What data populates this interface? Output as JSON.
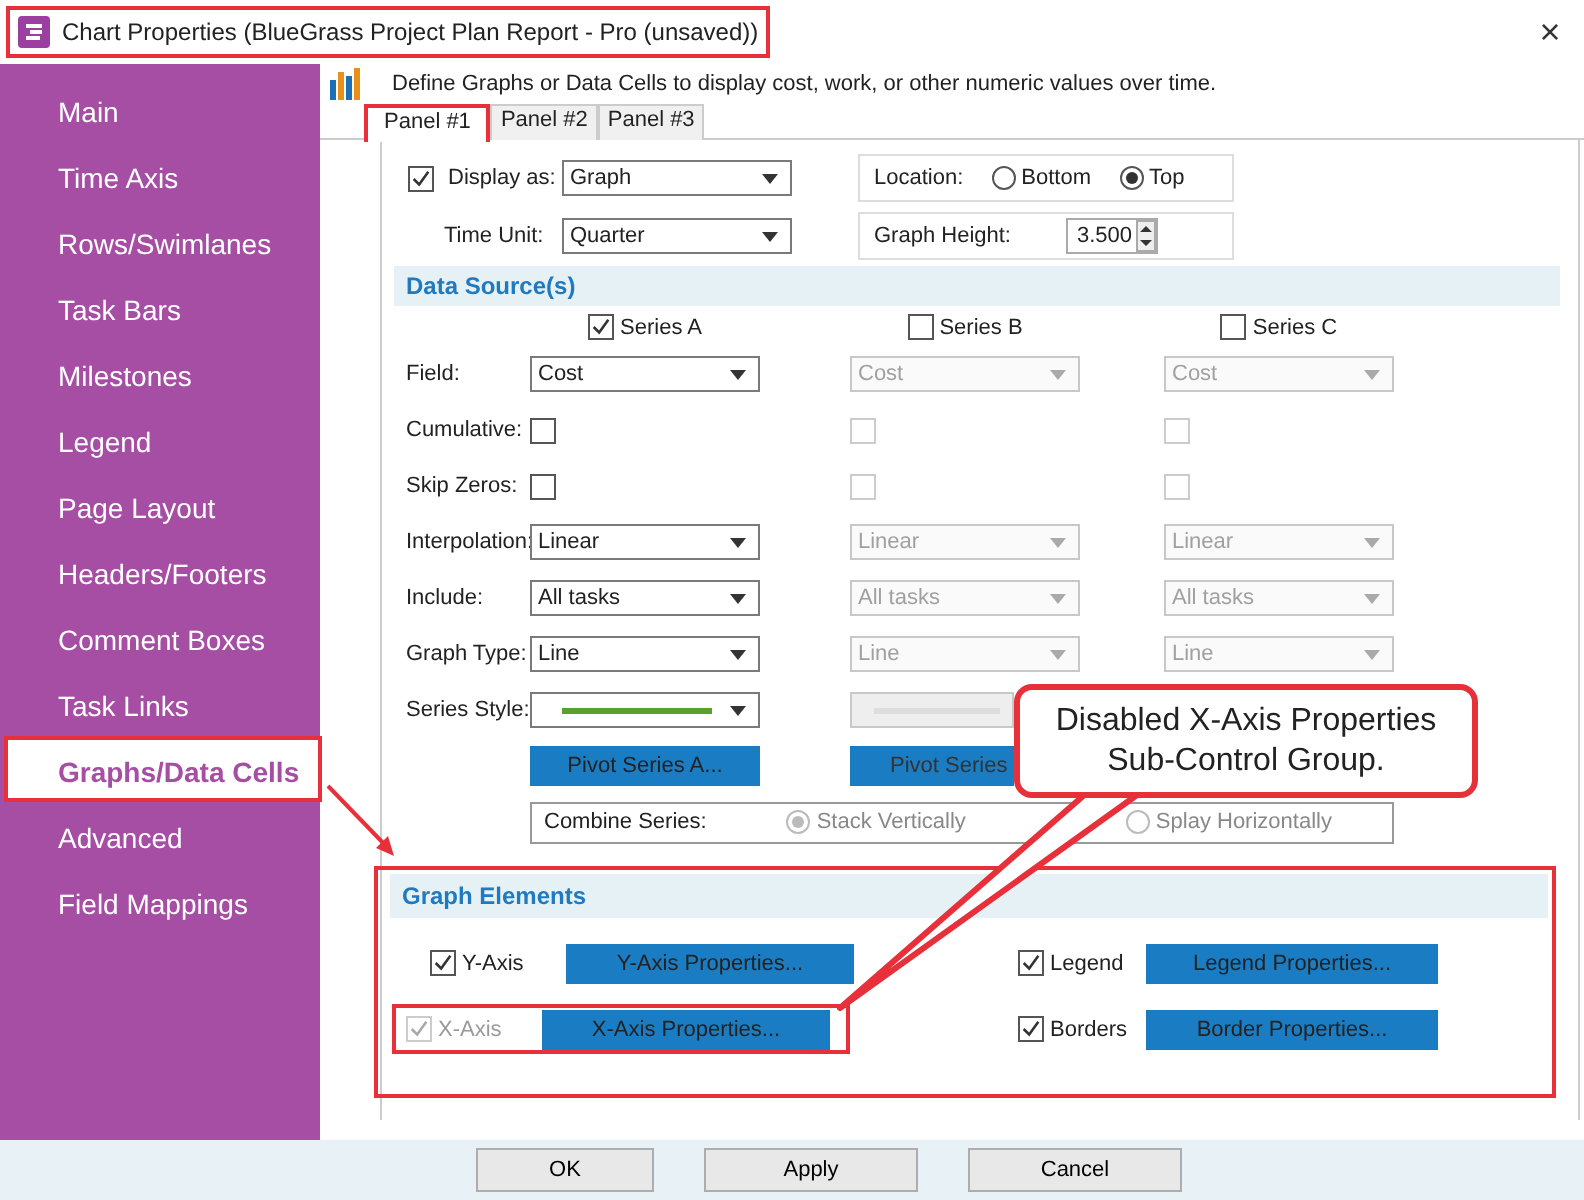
{
  "window": {
    "title": "Chart Properties (BlueGrass Project Plan Report - Pro (unsaved))",
    "highlighted": true,
    "close": "×"
  },
  "sidebar": {
    "items": [
      {
        "label": "Main",
        "selected": false
      },
      {
        "label": "Time Axis",
        "selected": false
      },
      {
        "label": "Rows/Swimlanes",
        "selected": false
      },
      {
        "label": "Task Bars",
        "selected": false
      },
      {
        "label": "Milestones",
        "selected": false
      },
      {
        "label": "Legend",
        "selected": false
      },
      {
        "label": "Page Layout",
        "selected": false
      },
      {
        "label": "Headers/Footers",
        "selected": false
      },
      {
        "label": "Comment Boxes",
        "selected": false
      },
      {
        "label": "Task Links",
        "selected": false
      },
      {
        "label": "Graphs/Data Cells",
        "selected": true
      },
      {
        "label": "Advanced",
        "selected": false
      },
      {
        "label": "Field Mappings",
        "selected": false
      }
    ]
  },
  "description": "Define Graphs or Data Cells to display cost, work, or other numeric values over time.",
  "tabs": [
    {
      "label": "Panel #1",
      "selected": true,
      "highlighted": true
    },
    {
      "label": "Panel #2",
      "selected": false,
      "highlighted": false
    },
    {
      "label": "Panel #3",
      "selected": false,
      "highlighted": false
    }
  ],
  "display_as": {
    "label": "Display as:",
    "checked": true,
    "value": "Graph"
  },
  "time_unit": {
    "label": "Time Unit:",
    "value": "Quarter"
  },
  "location": {
    "label": "Location:",
    "options": [
      {
        "label": "Bottom",
        "selected": false
      },
      {
        "label": "Top",
        "selected": true
      }
    ]
  },
  "graph_height": {
    "label": "Graph Height:",
    "value": "3.500"
  },
  "data_sources": {
    "title": "Data Source(s)",
    "series": [
      {
        "label": "Series A",
        "checked": true
      },
      {
        "label": "Series B",
        "checked": false
      },
      {
        "label": "Series C",
        "checked": false
      }
    ],
    "rows": [
      {
        "kind": "dropdown",
        "label": "Field:",
        "cells": [
          {
            "value": "Cost",
            "disabled": false
          },
          {
            "value": "Cost",
            "disabled": true
          },
          {
            "value": "Cost",
            "disabled": true
          }
        ]
      },
      {
        "kind": "checkbox",
        "label": "Cumulative:",
        "cells": [
          {
            "checked": false,
            "disabled": false
          },
          {
            "checked": false,
            "disabled": true
          },
          {
            "checked": false,
            "disabled": true
          }
        ]
      },
      {
        "kind": "checkbox",
        "label": "Skip Zeros:",
        "cells": [
          {
            "checked": false,
            "disabled": false
          },
          {
            "checked": false,
            "disabled": true
          },
          {
            "checked": false,
            "disabled": true
          }
        ]
      },
      {
        "kind": "dropdown",
        "label": "Interpolation:",
        "cells": [
          {
            "value": "Linear",
            "disabled": false
          },
          {
            "value": "Linear",
            "disabled": true
          },
          {
            "value": "Linear",
            "disabled": true
          }
        ]
      },
      {
        "kind": "dropdown",
        "label": "Include:",
        "cells": [
          {
            "value": "All tasks",
            "disabled": false
          },
          {
            "value": "All tasks",
            "disabled": true
          },
          {
            "value": "All tasks",
            "disabled": true
          }
        ]
      },
      {
        "kind": "dropdown",
        "label": "Graph Type:",
        "cells": [
          {
            "value": "Line",
            "disabled": false
          },
          {
            "value": "Line",
            "disabled": true
          },
          {
            "value": "Line",
            "disabled": true
          }
        ]
      },
      {
        "kind": "style",
        "label": "Series Style:",
        "cells": [
          {
            "color": "#5aa02c",
            "disabled": false
          },
          {
            "disabled": true
          }
        ]
      },
      {
        "kind": "button",
        "cells": [
          {
            "label": "Pivot Series A..."
          },
          {
            "label": "Pivot Series"
          }
        ]
      }
    ],
    "combine": {
      "label": "Combine Series:",
      "options": [
        {
          "label": "Stack Vertically",
          "selected": true,
          "disabled": true
        },
        {
          "label": "Splay Horizontally",
          "selected": false,
          "disabled": true
        }
      ]
    }
  },
  "graph_elements": {
    "title": "Graph Elements",
    "highlighted": true,
    "items": [
      {
        "label": "Y-Axis",
        "checked": true,
        "disabled": false,
        "highlighted": false,
        "button": "Y-Axis Properties..."
      },
      {
        "label": "Legend",
        "checked": true,
        "disabled": false,
        "highlighted": false,
        "button": "Legend Properties..."
      },
      {
        "label": "X-Axis",
        "checked": true,
        "disabled": true,
        "highlighted": true,
        "button": "X-Axis Properties..."
      },
      {
        "label": "Borders",
        "checked": true,
        "disabled": false,
        "highlighted": false,
        "button": "Border Properties..."
      }
    ]
  },
  "callout": {
    "text": "Disabled X-Axis Properties Sub-Control Group."
  },
  "buttons": [
    "OK",
    "Apply",
    "Cancel"
  ]
}
